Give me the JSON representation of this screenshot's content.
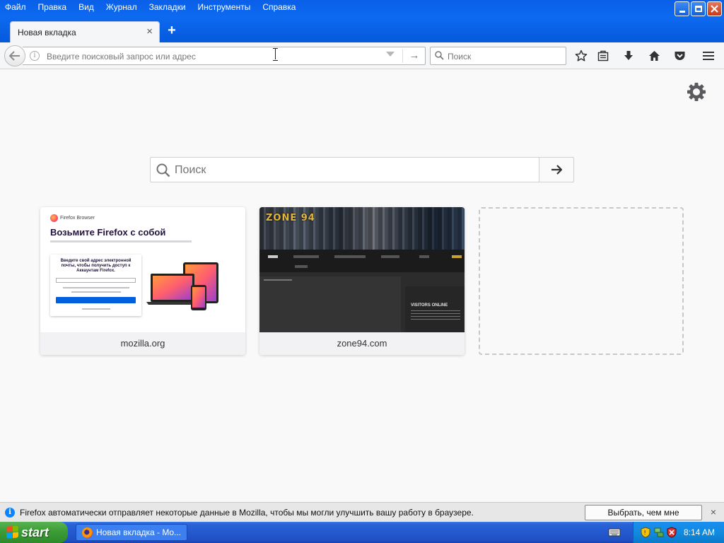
{
  "menu": [
    "Файл",
    "Правка",
    "Вид",
    "Журнал",
    "Закладки",
    "Инструменты",
    "Справка"
  ],
  "tab": {
    "title": "Новая вкладка",
    "close": "×",
    "new": "+"
  },
  "urlbar": {
    "placeholder": "Введите поисковый запрос или адрес",
    "go": "→",
    "info": "i"
  },
  "searchbar": {
    "placeholder": "Поиск"
  },
  "newtab_search": {
    "placeholder": "Поиск"
  },
  "tiles": [
    {
      "label": "mozilla.org",
      "thumb": {
        "brand": "Firefox Browser",
        "heading": "Возьмите Firefox с собой",
        "card_text": "Введите свой адрес электронной почты, чтобы получить доступ к Аккаунтам Firefox."
      }
    },
    {
      "label": "zone94.com",
      "thumb": {
        "logo": "ZONE 94",
        "side_title": "VISITORS ONLINE"
      }
    }
  ],
  "notification": {
    "icon": "i",
    "text": "Firefox автоматически отправляет некоторые данные в Mozilla, чтобы мы могли улучшить вашу работу в браузере.",
    "button": "Выбрать, чем мне поделиться",
    "close": "×"
  },
  "taskbar": {
    "start": "start",
    "task_item": "Новая вкладка - Mo...",
    "clock": "8:14 AM"
  },
  "colors": {
    "titlebar": "#0a5fe8",
    "accent": "#0a84ff",
    "start_green": "#3c9c36"
  },
  "icons": [
    "back-arrow-icon",
    "info-icon",
    "dropmarker-icon",
    "go-arrow-icon",
    "search-icon",
    "star-icon",
    "reading-list-icon",
    "download-icon",
    "home-icon",
    "pocket-icon",
    "hamburger-menu-icon",
    "gear-icon"
  ]
}
